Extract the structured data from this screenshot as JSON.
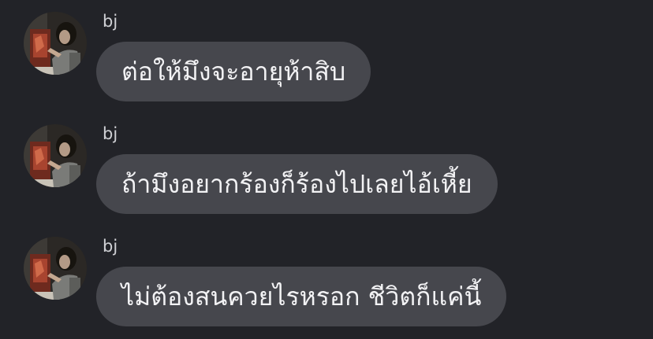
{
  "theme": {
    "background": "#222328",
    "bubble_color": "#46474d",
    "text_color": "#f2f2f4",
    "sender_color": "#cfd0d4"
  },
  "messages": [
    {
      "sender": "bj",
      "avatar_icon": "user-avatar-painting-photo",
      "text": "ต่อให้มึงจะอายุห้าสิบ"
    },
    {
      "sender": "bj",
      "avatar_icon": "user-avatar-painting-photo",
      "text": "ถ้ามึงอยากร้องก็ร้องไปเลยไอ้เหี้ย"
    },
    {
      "sender": "bj",
      "avatar_icon": "user-avatar-painting-photo",
      "text": "ไม่ต้องสนควยไรหรอก ชีวิตก็แค่นี้"
    }
  ]
}
